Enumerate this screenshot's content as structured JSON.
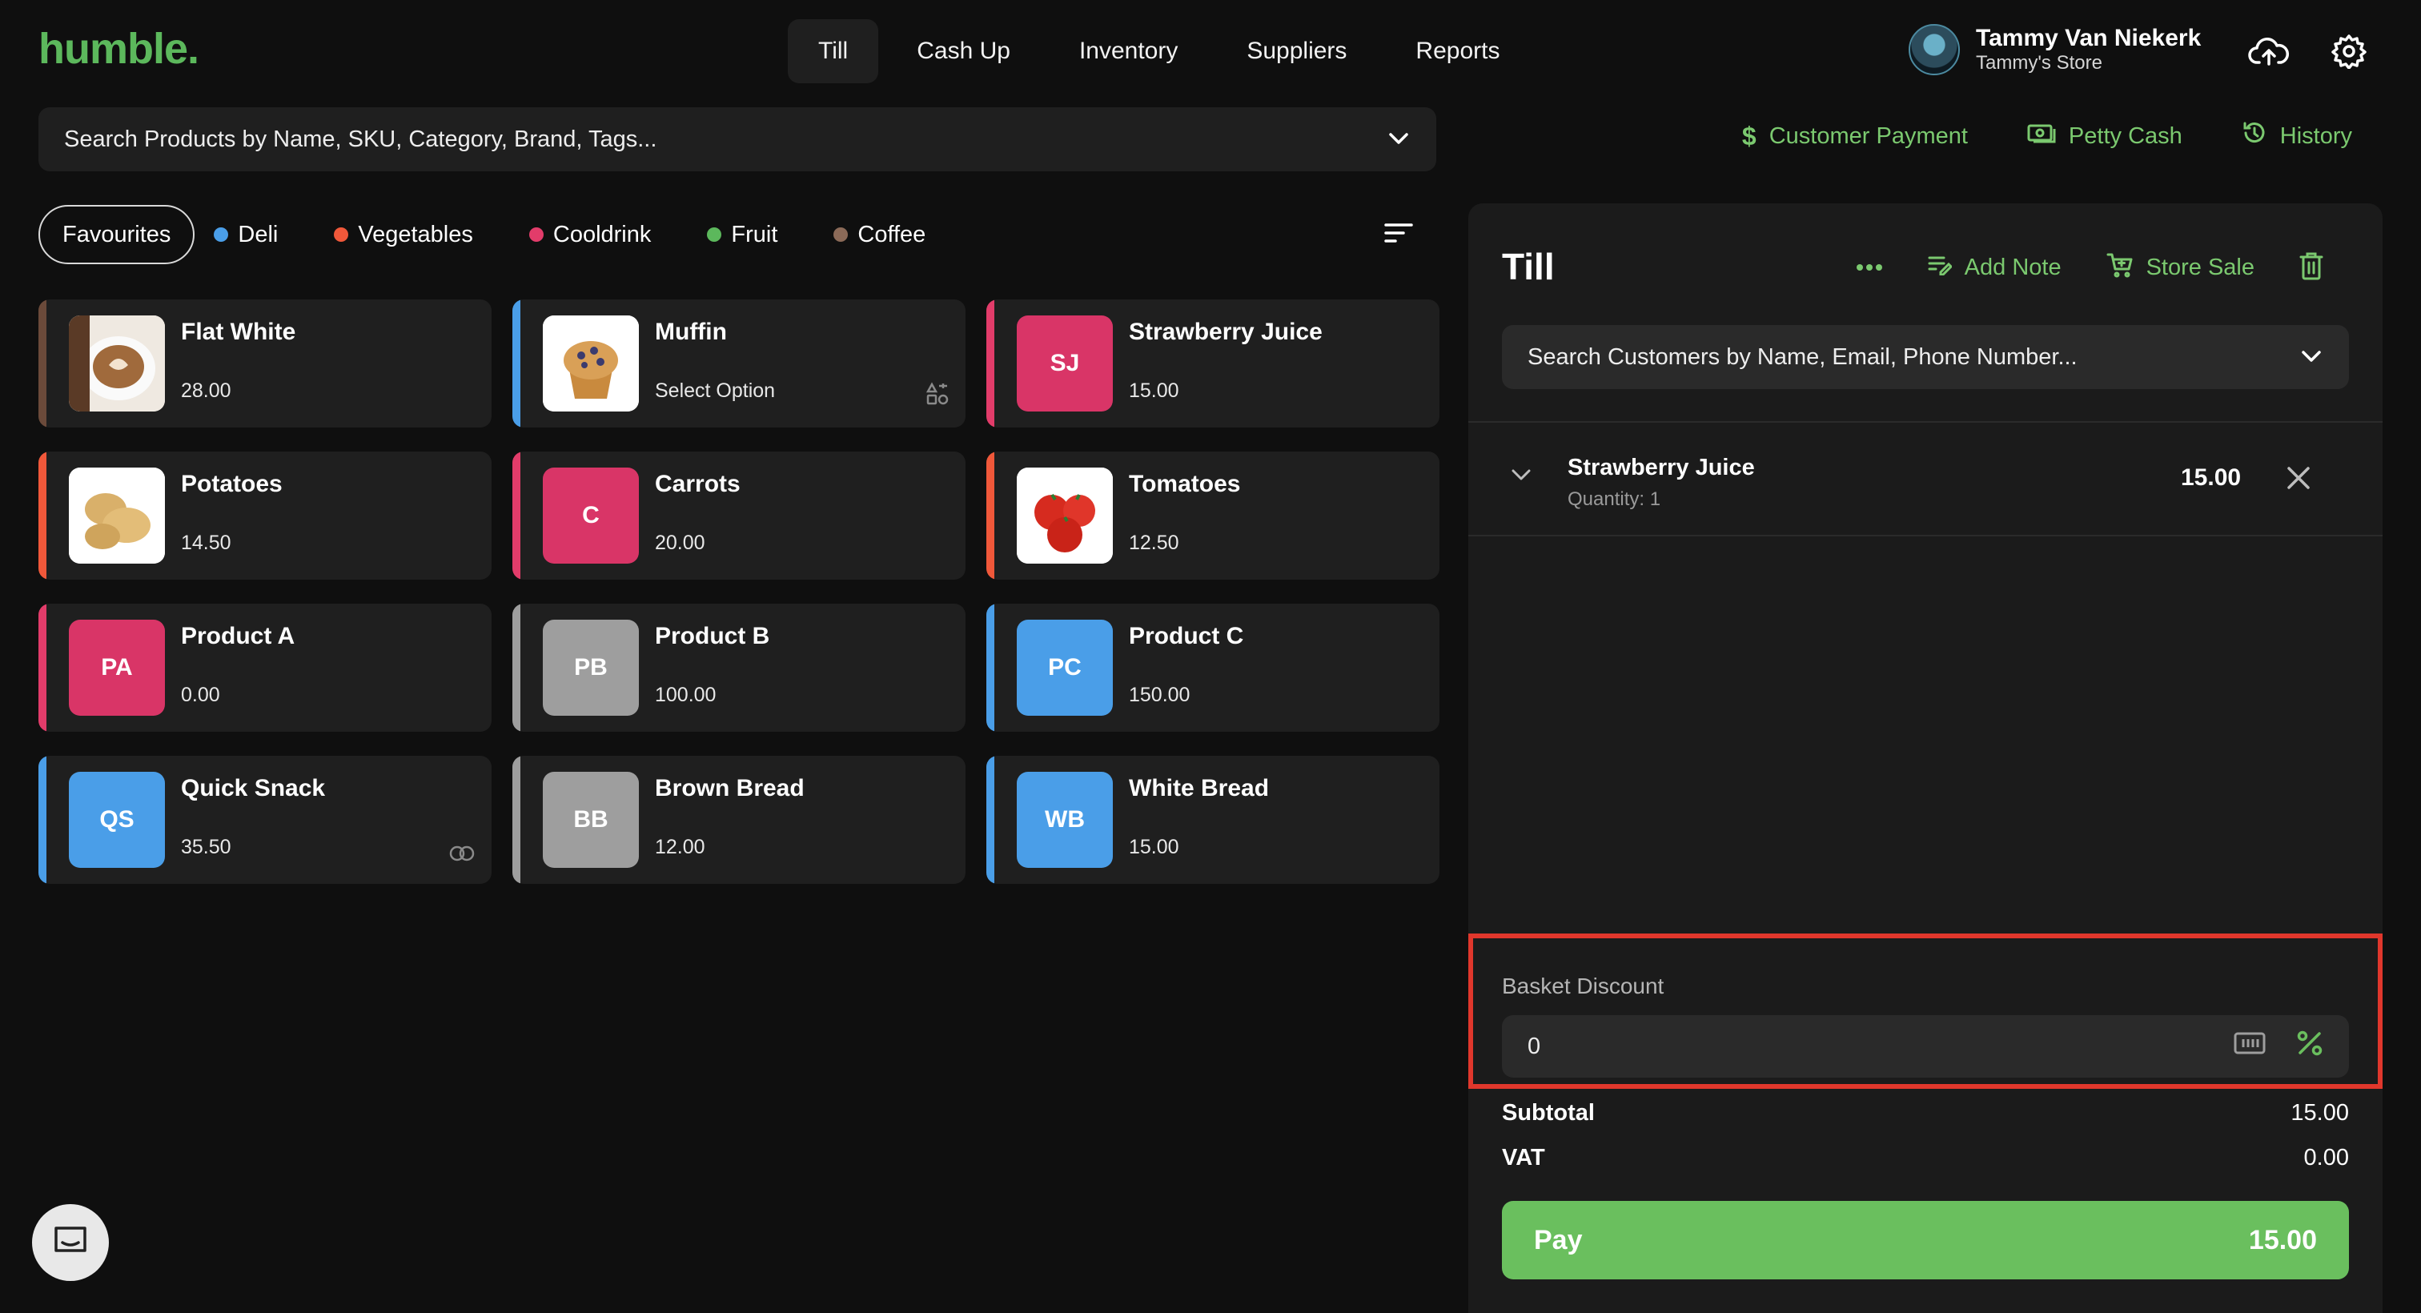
{
  "app": {
    "logo": "humble."
  },
  "nav": [
    {
      "label": "Till",
      "active": true
    },
    {
      "label": "Cash Up",
      "active": false
    },
    {
      "label": "Inventory",
      "active": false
    },
    {
      "label": "Suppliers",
      "active": false
    },
    {
      "label": "Reports",
      "active": false
    }
  ],
  "user": {
    "name": "Tammy Van Niekerk",
    "store": "Tammy's Store"
  },
  "product_search": {
    "placeholder": "Search Products by Name, SKU, Category, Brand, Tags..."
  },
  "actions": {
    "customer_payment": "Customer Payment",
    "petty_cash": "Petty Cash",
    "history": "History"
  },
  "categories": {
    "favourites": "Favourites",
    "items": [
      {
        "label": "Deli",
        "color": "#4a9ee8"
      },
      {
        "label": "Vegetables",
        "color": "#f0583a"
      },
      {
        "label": "Cooldrink",
        "color": "#e23c6a"
      },
      {
        "label": "Fruit",
        "color": "#5cb85c"
      },
      {
        "label": "Coffee",
        "color": "#8b6a58"
      }
    ]
  },
  "products": [
    {
      "name": "Flat White",
      "price": "28.00",
      "bar": "#6b4a3a",
      "thumb": "coffee-image"
    },
    {
      "name": "Muffin",
      "price": "Select Option",
      "bar": "#4a9ee8",
      "thumb": "muffin-image"
    },
    {
      "name": "Strawberry Juice",
      "price": "15.00",
      "bar": "#e23c6a",
      "initials": "SJ",
      "tile": "#d93567"
    },
    {
      "name": "Potatoes",
      "price": "14.50",
      "bar": "#f0583a",
      "thumb": "potatoes-image"
    },
    {
      "name": "Carrots",
      "price": "20.00",
      "bar": "#e23c6a",
      "initials": "C",
      "tile": "#d93567"
    },
    {
      "name": "Tomatoes",
      "price": "12.50",
      "bar": "#f0583a",
      "thumb": "tomatoes-image"
    },
    {
      "name": "Product A",
      "price": "0.00",
      "bar": "#e23c6a",
      "initials": "PA",
      "tile": "#d93567"
    },
    {
      "name": "Product B",
      "price": "100.00",
      "bar": "#9e9e9e",
      "initials": "PB",
      "tile": "#9e9e9e"
    },
    {
      "name": "Product C",
      "price": "150.00",
      "bar": "#4a9ee8",
      "initials": "PC",
      "tile": "#4a9ee8"
    },
    {
      "name": "Quick Snack",
      "price": "35.50",
      "bar": "#4a9ee8",
      "initials": "QS",
      "tile": "#4a9ee8"
    },
    {
      "name": "Brown Bread",
      "price": "12.00",
      "bar": "#9e9e9e",
      "initials": "BB",
      "tile": "#9e9e9e"
    },
    {
      "name": "White Bread",
      "price": "15.00",
      "bar": "#4a9ee8",
      "initials": "WB",
      "tile": "#4a9ee8"
    }
  ],
  "till": {
    "title": "Till",
    "add_note": "Add Note",
    "store_sale": "Store Sale",
    "customer_search": {
      "placeholder": "Search Customers by Name, Email, Phone Number..."
    },
    "line_items": [
      {
        "name": "Strawberry Juice",
        "quantity": "Quantity: 1",
        "price": "15.00"
      }
    ],
    "basket_discount": {
      "label": "Basket Discount",
      "value": "0"
    },
    "subtotal": {
      "label": "Subtotal",
      "value": "15.00"
    },
    "vat": {
      "label": "VAT",
      "value": "0.00"
    },
    "pay": {
      "label": "Pay",
      "amount": "15.00"
    }
  },
  "colors": {
    "accent": "#6abf5e",
    "highlight": "#e0372c",
    "background": "#0f0f0f"
  }
}
